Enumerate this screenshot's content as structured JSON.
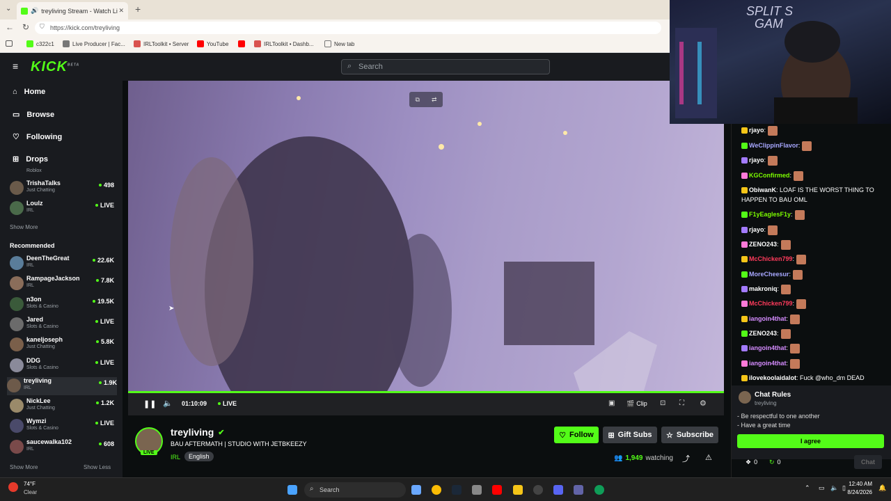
{
  "browser": {
    "tab_title": "treyliving Stream - Watch Live",
    "url": "https://kick.com/treyliving",
    "bookmarks": [
      "c322c1",
      "Live Producer | Fac...",
      "IRLToolkit • Server",
      "YouTube",
      "IRLToolkit • Dashb...",
      "New tab"
    ]
  },
  "header": {
    "logo": "KICK",
    "logo_beta": "BETA",
    "search_placeholder": "Search"
  },
  "sidebar": {
    "nav": [
      "Home",
      "Browse",
      "Following",
      "Drops"
    ],
    "following": [
      {
        "name": "",
        "category": "Roblox",
        "viewers": ""
      },
      {
        "name": "TrishaTalks",
        "category": "Just Chatting",
        "viewers": "498"
      },
      {
        "name": "Loulz",
        "category": "IRL",
        "viewers": "LIVE"
      }
    ],
    "show_more": "Show More",
    "recommended_title": "Recommended",
    "recommended": [
      {
        "name": "DeenTheGreat",
        "category": "IRL",
        "viewers": "22.6K",
        "color": "#5a7d9a"
      },
      {
        "name": "RampageJackson",
        "category": "IRL",
        "viewers": "7.8K",
        "color": "#8a6d5a"
      },
      {
        "name": "n3on",
        "category": "Slots & Casino",
        "viewers": "19.5K",
        "color": "#3a5a3a"
      },
      {
        "name": "Jared",
        "category": "Slots & Casino",
        "viewers": "LIVE",
        "color": "#6b6b6b"
      },
      {
        "name": "kaneljoseph",
        "category": "Just Chatting",
        "viewers": "5.8K",
        "color": "#7a5f4a"
      },
      {
        "name": "DDG",
        "category": "Slots & Casino",
        "viewers": "LIVE",
        "color": "#8a8a9a"
      },
      {
        "name": "treyliving",
        "category": "IRL",
        "viewers": "1.9K",
        "color": "#6d5a4a"
      },
      {
        "name": "NickLee",
        "category": "Just Chatting",
        "viewers": "1.2K",
        "color": "#9a8a6a"
      },
      {
        "name": "Wymzi",
        "category": "Slots & Casino",
        "viewers": "LIVE",
        "color": "#4a4a6a"
      },
      {
        "name": "saucewalka102",
        "category": "IRL",
        "viewers": "608",
        "color": "#7a4a4a"
      }
    ],
    "show_more_bottom": "Show More",
    "show_less": "Show Less"
  },
  "player": {
    "time": "01:10:09",
    "live": "LIVE",
    "clip": "Clip",
    "progress": 1.0
  },
  "channel": {
    "name": "treyliving",
    "title": "BAU AFTERMATH | STUDIO WITH JETBKEEZY",
    "category": "IRL",
    "language": "English",
    "live_badge": "LIVE",
    "follow": "Follow",
    "gift_subs": "Gift Subs",
    "subscribe": "Subscribe",
    "viewers": "1,949",
    "watching": "watching"
  },
  "chat": {
    "messages": [
      {
        "user": "rjayo",
        "color": "#fff",
        "text": ":"
      },
      {
        "user": "WeClippinFlavor",
        "color": "#a7a7ff",
        "text": ":"
      },
      {
        "user": "rjayo",
        "color": "#fff",
        "text": ":"
      },
      {
        "user": "KGConfirmed",
        "color": "#7cfc00",
        "text": ":"
      },
      {
        "user": "ObiwanK",
        "color": "#fff",
        "text": ": LOAF IS THE WORST THING TO HAPPEN TO BAU OML"
      },
      {
        "user": "F1yEaglesF1y",
        "color": "#7cfc00",
        "text": ":"
      },
      {
        "user": "rjayo",
        "color": "#fff",
        "text": ":"
      },
      {
        "user": "ZENO243",
        "color": "#fff",
        "text": ":"
      },
      {
        "user": "McChicken799",
        "color": "#ff3b5c",
        "text": ":"
      },
      {
        "user": "MoreCheesur",
        "color": "#a7a7ff",
        "text": ":"
      },
      {
        "user": "makroniq",
        "color": "#fff",
        "text": ":"
      },
      {
        "user": "McChicken799",
        "color": "#ff3b5c",
        "text": ":"
      },
      {
        "user": "iangoin4that",
        "color": "#d58cff",
        "text": ":"
      },
      {
        "user": "ZENO243",
        "color": "#fff",
        "text": ":"
      },
      {
        "user": "iangoin4that",
        "color": "#d58cff",
        "text": ":"
      },
      {
        "user": "iangoin4that",
        "color": "#d58cff",
        "text": ":"
      },
      {
        "user": "ilovekoolaidalot",
        "color": "#fff",
        "text": ": Fuck @who_dm DEAD"
      }
    ],
    "rules_title": "Chat Rules",
    "rules_channel": "treyliving",
    "rules": [
      "- Be respectful to one another",
      "- Have a great time"
    ],
    "agree": "I agree",
    "points_a": "0",
    "points_b": "0",
    "send": "Chat"
  },
  "webcam": {
    "overlay_text_1": "SPLIT S",
    "overlay_text_2": "GAM"
  },
  "taskbar": {
    "weather_temp": "74°F",
    "weather_cond": "Clear",
    "search": "Search",
    "time": "12:40 AM",
    "date": "8/24/2026"
  },
  "colors": {
    "accent": "#53fc18",
    "bg": "#0b0e0f",
    "panel": "#191b1f"
  }
}
